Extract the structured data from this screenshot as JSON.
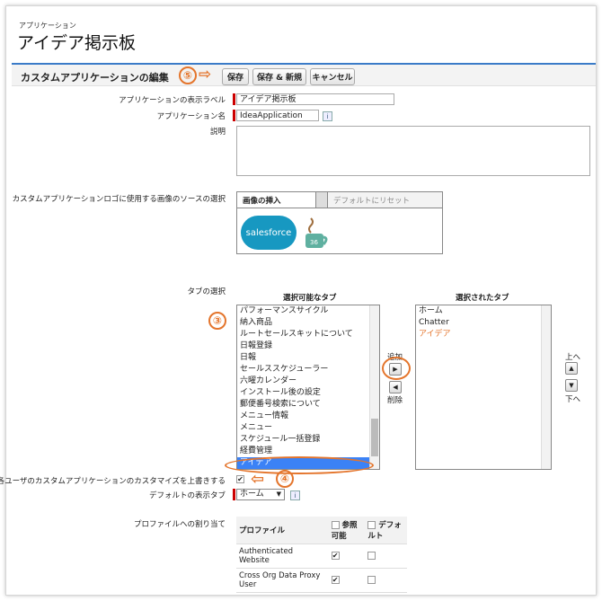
{
  "header": {
    "small_title": "アプリケーション",
    "title": "アイデア掲示板"
  },
  "toolbar": {
    "heading": "カスタムアプリケーションの編集",
    "save": "保存",
    "save_new": "保存 & 新規",
    "cancel": "キャンセル",
    "step5": "⑤"
  },
  "form": {
    "display_label_label": "アプリケーションの表示ラベル",
    "display_label_value": "アイデア掲示板",
    "app_name_label": "アプリケーション名",
    "app_name_value": "IdeaApplication",
    "description_label": "説明",
    "logo_label": "カスタムアプリケーションロゴに使用する画像のソースの選択",
    "logo_tab_insert": "画像の挿入",
    "logo_tab_reset": "デフォルトにリセット",
    "logo_text": "salesforce",
    "logo_cup_number": "36",
    "tab_select_label": "タブの選択",
    "available_title": "選択可能なタブ",
    "selected_title": "選択されたタブ",
    "available_tabs": [
      "パフォーマンスサイクル",
      "納入商品",
      "ルートセールスキットについて",
      "日報登録",
      "日報",
      "セールススケジューラー",
      "六曜カレンダー",
      "インストール後の設定",
      "郵便番号検索について",
      "メニュー情報",
      "メニュー",
      "スケジュール一括登録",
      "経費管理",
      "アイデア"
    ],
    "selected_tabs": [
      "ホーム",
      "Chatter",
      "アイデア"
    ],
    "add_label": "追加",
    "remove_label": "削除",
    "up_label": "上へ",
    "down_label": "下へ",
    "step3": "③",
    "step4": "④",
    "override_label": "各ユーザのカスタムアプリケーションのカスタマイズを上書きする",
    "default_tab_label": "デフォルトの表示タブ",
    "default_tab_value": "ホーム",
    "profile_label": "プロファイルへの割り当て",
    "profile_headers": [
      "プロファイル",
      "参照可能",
      "デフォルト"
    ],
    "profiles": [
      {
        "name": "Authenticated Website",
        "visible": "✔",
        "default": ""
      },
      {
        "name": "Cross Org Data Proxy User",
        "visible": "✔",
        "default": ""
      }
    ],
    "info_icon": "i"
  },
  "colors": {
    "accent": "#e4752c",
    "selected": "#3b82f6"
  }
}
